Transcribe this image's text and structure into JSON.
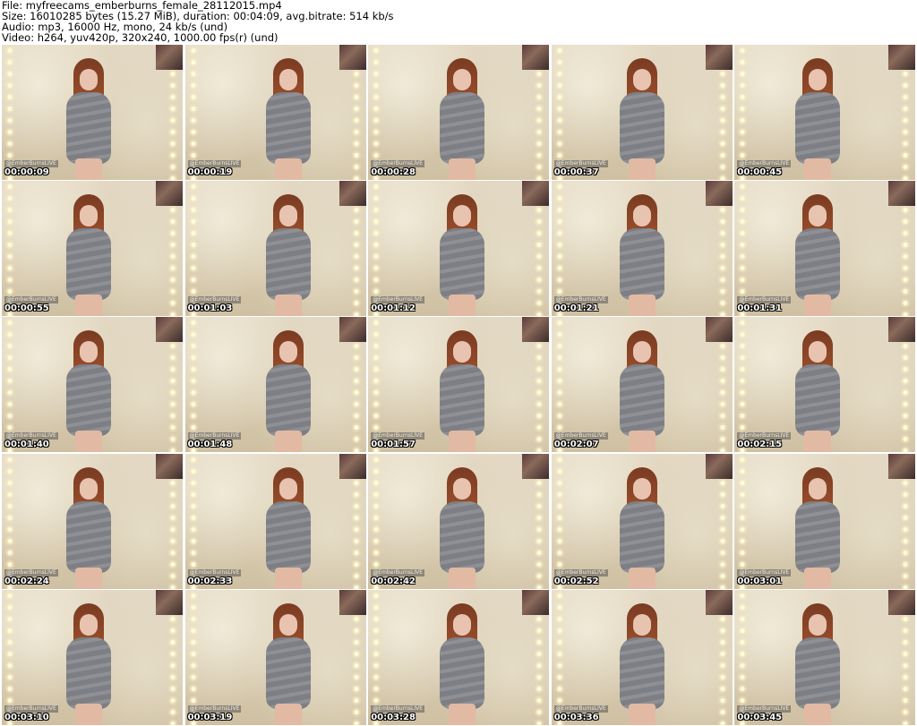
{
  "header": {
    "file_line": "File: myfreecams_emberburns_female_28112015.mp4",
    "size_line": "Size: 16010285 bytes (15.27 MiB), duration: 00:04:09, avg.bitrate: 514 kb/s",
    "audio_line": "Audio: mp3, 16000 Hz, mono, 24 kb/s (und)",
    "video_line": "Video: h264, yuv420p, 320x240, 1000.00 fps(r) (und)"
  },
  "watermark": "@EmberBurnsLIVE",
  "thumbnails": [
    {
      "time": "00:00:09"
    },
    {
      "time": "00:00:19"
    },
    {
      "time": "00:00:28"
    },
    {
      "time": "00:00:37"
    },
    {
      "time": "00:00:45"
    },
    {
      "time": "00:00:55"
    },
    {
      "time": "00:01:03"
    },
    {
      "time": "00:01:12"
    },
    {
      "time": "00:01:21"
    },
    {
      "time": "00:01:31"
    },
    {
      "time": "00:01:40"
    },
    {
      "time": "00:01:48"
    },
    {
      "time": "00:01:57"
    },
    {
      "time": "00:02:07"
    },
    {
      "time": "00:02:15"
    },
    {
      "time": "00:02:24"
    },
    {
      "time": "00:02:33"
    },
    {
      "time": "00:02:42"
    },
    {
      "time": "00:02:52"
    },
    {
      "time": "00:03:01"
    },
    {
      "time": "00:03:10"
    },
    {
      "time": "00:03:19"
    },
    {
      "time": "00:03:28"
    },
    {
      "time": "00:03:36"
    },
    {
      "time": "00:03:45"
    }
  ]
}
